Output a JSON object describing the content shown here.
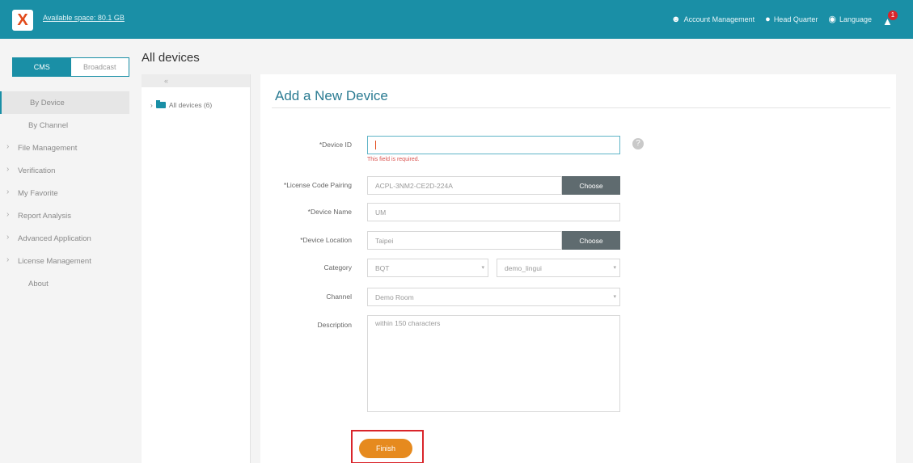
{
  "topbar": {
    "logo_letter": "X",
    "available_space": "Available space: 80.1 GB",
    "account_management": "Account Management",
    "head_quarter": "Head Quarter",
    "language": "Language",
    "notification_count": "1",
    "accent_color": "#1a8fa6"
  },
  "sidebar": {
    "tabs": {
      "cms": "CMS",
      "broadcast": "Broadcast"
    },
    "items": [
      {
        "label": "By Device"
      },
      {
        "label": "By Channel"
      },
      {
        "label": "File Management"
      },
      {
        "label": "Verification"
      },
      {
        "label": "My Favorite"
      },
      {
        "label": "Report Analysis"
      },
      {
        "label": "Advanced Application"
      },
      {
        "label": "License Management"
      },
      {
        "label": "About"
      }
    ]
  },
  "page": {
    "title": "All devices"
  },
  "tree": {
    "collapse": "«",
    "root_label": "All devices (6)"
  },
  "form": {
    "title": "Add a New Device",
    "device_id": {
      "label": "*Device ID",
      "value": "",
      "error": "This field is required."
    },
    "license": {
      "label": "*License Code Pairing",
      "value": "ACPL-3NM2-CE2D-224A",
      "button": "Choose"
    },
    "device_name": {
      "label": "*Device Name",
      "value": "UM"
    },
    "device_location": {
      "label": "*Device Location",
      "value": "Taipei",
      "button": "Choose"
    },
    "category": {
      "label": "Category",
      "value_1": "BQT",
      "value_2": "demo_lingui"
    },
    "channel": {
      "label": "Channel",
      "value": "Demo Room"
    },
    "description": {
      "label": "Description",
      "placeholder": "within 150 characters"
    },
    "finish": "Finish"
  }
}
